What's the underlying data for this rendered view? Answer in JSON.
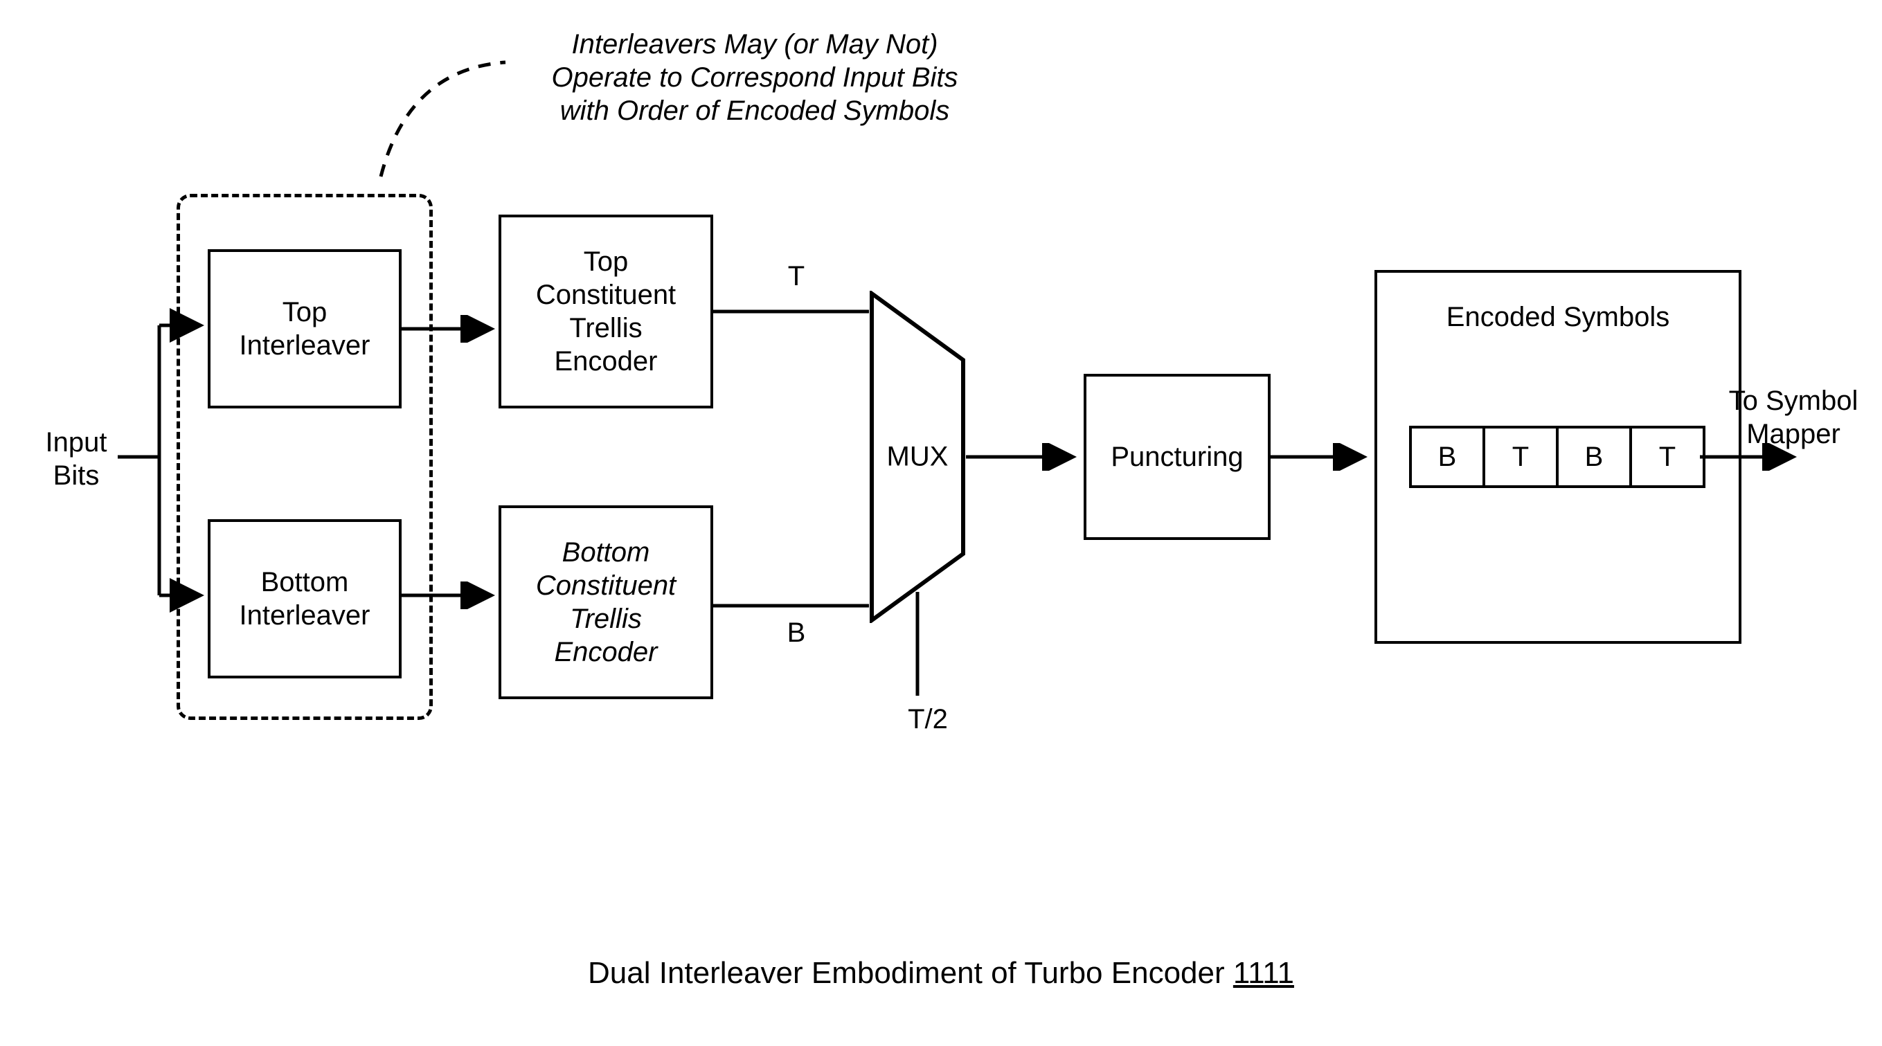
{
  "annotation": {
    "line1": "Interleavers May (or May Not)",
    "line2": "Operate to Correspond Input Bits",
    "line3": "with Order of Encoded Symbols"
  },
  "input_label_l1": "Input",
  "input_label_l2": "Bits",
  "top_interleaver_l1": "Top",
  "top_interleaver_l2": "Interleaver",
  "bottom_interleaver_l1": "Bottom",
  "bottom_interleaver_l2": "Interleaver",
  "top_encoder_l1": "Top",
  "top_encoder_l2": "Constituent",
  "top_encoder_l3": "Trellis",
  "top_encoder_l4": "Encoder",
  "bottom_encoder_l1": "Bottom",
  "bottom_encoder_l2": "Constituent",
  "bottom_encoder_l3": "Trellis",
  "bottom_encoder_l4": "Encoder",
  "signal_T": "T",
  "signal_B": "B",
  "mux_label": "MUX",
  "mux_clock": "T/2",
  "puncturing_label": "Puncturing",
  "encoded_symbols_title": "Encoded Symbols",
  "symbols": [
    "B",
    "T",
    "B",
    "T"
  ],
  "output_label_l1": "To Symbol",
  "output_label_l2": "Mapper",
  "caption_text": "Dual Interleaver Embodiment of Turbo Encoder ",
  "caption_ref": "1111"
}
